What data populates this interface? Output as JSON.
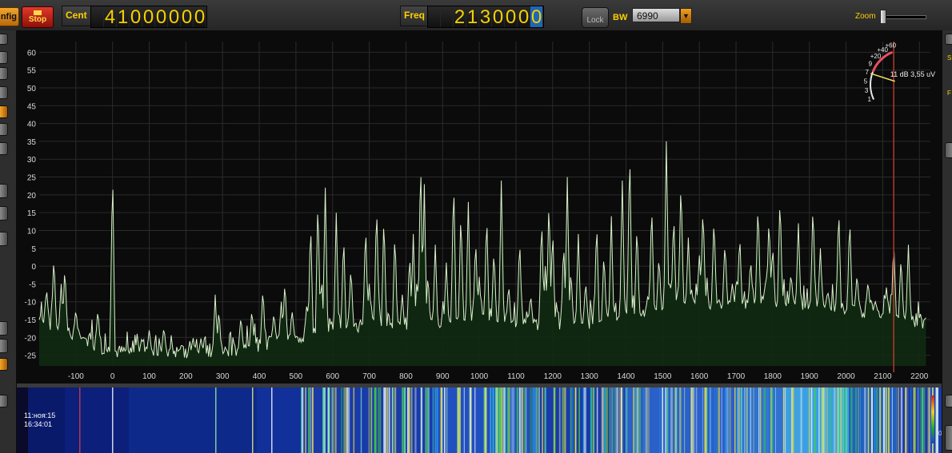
{
  "toolbar": {
    "config_label": "nfig",
    "stop_label": "Stop",
    "center_label": "Cent",
    "center_digits": [
      "",
      "4",
      "1",
      "0",
      "0",
      "0",
      "0",
      "0",
      "0"
    ],
    "freq_label": "Freq",
    "freq_digits": [
      "",
      "",
      "2",
      "1",
      "3",
      "0",
      "0",
      "0",
      "0"
    ],
    "freq_highlight_index": 8,
    "lock_label": "Lock",
    "bw_label": "BW",
    "bw_value": "6990",
    "zoom_label": "Zoom",
    "zoom_level": 0.0
  },
  "smeter": {
    "scale_labels": [
      "1",
      "3",
      "5",
      "7",
      "9",
      "+20",
      "+40",
      "+60"
    ],
    "readout": "11 dB 3,55 uV",
    "level_fraction": 0.46
  },
  "spectrum": {
    "y_ticks": [
      60,
      55,
      50,
      45,
      40,
      35,
      30,
      25,
      20,
      15,
      10,
      5,
      0,
      -5,
      -10,
      -15,
      -20,
      -25
    ],
    "x_ticks": [
      -100,
      0,
      100,
      200,
      300,
      400,
      500,
      600,
      700,
      800,
      900,
      1000,
      1100,
      1200,
      1300,
      1400,
      1500,
      1600,
      1700,
      1800,
      1900,
      2000,
      2100,
      2200
    ],
    "x_range": [
      -200,
      2230
    ],
    "y_range": [
      -28,
      63
    ],
    "vfo_marker": 2130,
    "noise_floor": [
      [
        -200,
        -15
      ],
      [
        0,
        -24
      ],
      [
        200,
        -24
      ],
      [
        300,
        -24
      ],
      [
        400,
        -22
      ],
      [
        500,
        -20
      ],
      [
        600,
        -18
      ],
      [
        700,
        -16
      ],
      [
        800,
        -18
      ],
      [
        900,
        -16
      ],
      [
        1000,
        -15
      ],
      [
        1100,
        -16
      ],
      [
        1200,
        -16
      ],
      [
        1300,
        -16
      ],
      [
        1400,
        -14
      ],
      [
        1500,
        -12
      ],
      [
        1600,
        -10
      ],
      [
        1700,
        -11
      ],
      [
        1800,
        -10
      ],
      [
        1900,
        -11
      ],
      [
        2000,
        -12
      ],
      [
        2100,
        -13
      ],
      [
        2200,
        -16
      ]
    ],
    "peaks": [
      [
        -180,
        -6
      ],
      [
        -160,
        3
      ],
      [
        -140,
        -5
      ],
      [
        -130,
        0
      ],
      [
        -100,
        -12
      ],
      [
        -80,
        -20
      ],
      [
        -40,
        -12
      ],
      [
        0,
        29
      ],
      [
        80,
        -20
      ],
      [
        100,
        -18
      ],
      [
        140,
        -17
      ],
      [
        220,
        -21
      ],
      [
        280,
        -8
      ],
      [
        290,
        -12
      ],
      [
        350,
        -14
      ],
      [
        380,
        -12
      ],
      [
        410,
        -6
      ],
      [
        440,
        -13
      ],
      [
        460,
        -10
      ],
      [
        470,
        -4
      ],
      [
        490,
        -13
      ],
      [
        530,
        -10
      ],
      [
        540,
        13
      ],
      [
        560,
        20
      ],
      [
        570,
        -3
      ],
      [
        580,
        22
      ],
      [
        610,
        15
      ],
      [
        630,
        9
      ],
      [
        650,
        0
      ],
      [
        690,
        12
      ],
      [
        700,
        -5
      ],
      [
        720,
        18
      ],
      [
        740,
        15
      ],
      [
        770,
        10
      ],
      [
        790,
        -8
      ],
      [
        810,
        4
      ],
      [
        820,
        9
      ],
      [
        830,
        -3
      ],
      [
        840,
        32
      ],
      [
        850,
        23
      ],
      [
        860,
        -2
      ],
      [
        880,
        6
      ],
      [
        910,
        1
      ],
      [
        930,
        25
      ],
      [
        950,
        16
      ],
      [
        970,
        18
      ],
      [
        990,
        8
      ],
      [
        1000,
        -3
      ],
      [
        1020,
        15
      ],
      [
        1040,
        5
      ],
      [
        1060,
        24
      ],
      [
        1080,
        -5
      ],
      [
        1110,
        8
      ],
      [
        1140,
        -8
      ],
      [
        1170,
        14
      ],
      [
        1180,
        0
      ],
      [
        1190,
        20
      ],
      [
        1200,
        11
      ],
      [
        1230,
        7
      ],
      [
        1240,
        25
      ],
      [
        1250,
        -1
      ],
      [
        1270,
        9
      ],
      [
        1290,
        -4
      ],
      [
        1320,
        13
      ],
      [
        1340,
        4
      ],
      [
        1360,
        14
      ],
      [
        1390,
        24
      ],
      [
        1410,
        34
      ],
      [
        1430,
        12
      ],
      [
        1460,
        -8
      ],
      [
        1470,
        18
      ],
      [
        1490,
        3
      ],
      [
        1510,
        35
      ],
      [
        1520,
        -4
      ],
      [
        1530,
        15
      ],
      [
        1550,
        25
      ],
      [
        1570,
        8
      ],
      [
        1580,
        -8
      ],
      [
        1600,
        3
      ],
      [
        1610,
        17
      ],
      [
        1640,
        14
      ],
      [
        1670,
        7
      ],
      [
        1690,
        -5
      ],
      [
        1710,
        9
      ],
      [
        1740,
        2
      ],
      [
        1760,
        18
      ],
      [
        1780,
        -5
      ],
      [
        1790,
        14
      ],
      [
        1800,
        6
      ],
      [
        1820,
        20
      ],
      [
        1850,
        -2
      ],
      [
        1870,
        12
      ],
      [
        1910,
        18
      ],
      [
        1930,
        5
      ],
      [
        1950,
        -7
      ],
      [
        1980,
        17
      ],
      [
        2010,
        14
      ],
      [
        2030,
        -2
      ],
      [
        2060,
        -4
      ],
      [
        2080,
        -10
      ],
      [
        2110,
        -6
      ],
      [
        2130,
        7
      ],
      [
        2150,
        3
      ],
      [
        2170,
        6
      ]
    ]
  },
  "waterfall": {
    "date": "11:ноя:15",
    "time": "16:34:01",
    "legend_bottom": "0"
  }
}
